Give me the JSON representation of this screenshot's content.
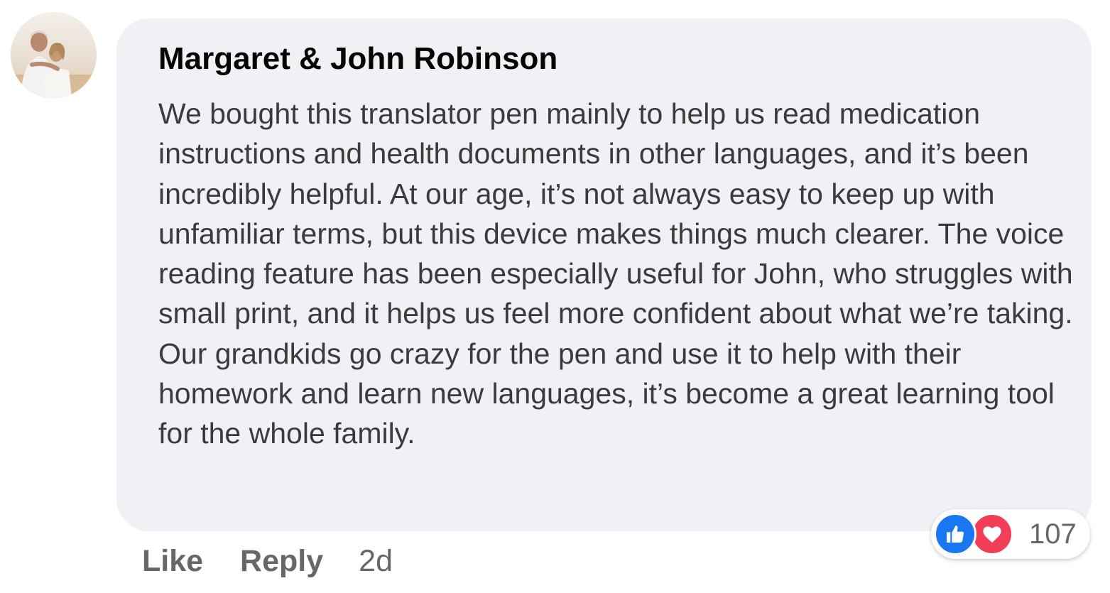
{
  "comment": {
    "author": "Margaret & John Robinson",
    "text": "We bought this translator pen mainly to help us read medication instructions and health documents in other languages, and it’s been incredibly helpful. At our age, it’s not always easy to keep up with unfamiliar terms, but this device makes things much clearer. The voice reading feature has been especially useful for John, who struggles with small print, and it helps us feel more confident about what we’re taking.\nOur grandkids go crazy for the pen and use it to help with their homework and learn new languages, it’s become a great learning tool for the whole family.",
    "like_label": "Like",
    "reply_label": "Reply",
    "timestamp": "2d",
    "reaction_count": "107"
  },
  "colors": {
    "bubble_bg": "#f0f1f5",
    "like_blue": "#1877f2",
    "love_red": "#f33e58",
    "meta_gray": "#65676b"
  },
  "icons": {
    "avatar": "profile-photo",
    "like": "thumbs-up-icon",
    "love": "heart-icon"
  }
}
